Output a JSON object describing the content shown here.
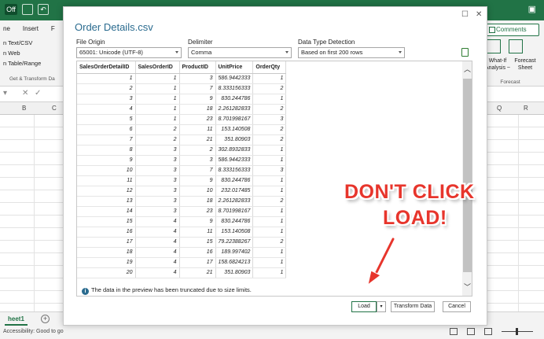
{
  "excel": {
    "titlebar_chip1": "Off",
    "ribbon_tabs": [
      "ne",
      "Insert",
      "F"
    ],
    "ribbon_left_items": [
      "n Text/CSV",
      "n Web",
      "n Table/Range"
    ],
    "ribbon_left_group": "Get & Transform Da",
    "comments_label": "Comments",
    "forecast": {
      "whatif": "What-If Analysis ~",
      "sheet": "Forecast Sheet",
      "group": "Forecast"
    },
    "formula_cancel": "✕",
    "formula_enter": "✓",
    "columns_left": [
      "B",
      "C"
    ],
    "columns_right": [
      "Q",
      "R"
    ],
    "sheet_tab": "heet1",
    "status_text": "Accessibility: Good to go"
  },
  "dialog": {
    "title": "Order Details.csv",
    "minimize_glyph": "☐",
    "close_glyph": "✕",
    "file_origin_label": "File Origin",
    "file_origin_value": "65001: Unicode (UTF-8)",
    "delimiter_label": "Delimiter",
    "delimiter_value": "Comma",
    "detection_label": "Data Type Detection",
    "detection_value": "Based on first 200 rows",
    "columns": [
      "SalesOrderDetailID",
      "SalesOrderID",
      "ProductID",
      "UnitPrice",
      "OrderQty"
    ],
    "rows": [
      [
        "1",
        "1",
        "3",
        "586.9442333",
        "1"
      ],
      [
        "2",
        "1",
        "7",
        "8.333156333",
        "2"
      ],
      [
        "3",
        "1",
        "9",
        "830.244786",
        "1"
      ],
      [
        "4",
        "1",
        "18",
        "2.261282833",
        "2"
      ],
      [
        "5",
        "1",
        "23",
        "8.701998167",
        "3"
      ],
      [
        "6",
        "2",
        "11",
        "153.140508",
        "2"
      ],
      [
        "7",
        "2",
        "21",
        "351.80903",
        "2"
      ],
      [
        "8",
        "3",
        "2",
        "302.8932833",
        "1"
      ],
      [
        "9",
        "3",
        "3",
        "586.9442333",
        "1"
      ],
      [
        "10",
        "3",
        "7",
        "8.333156333",
        "3"
      ],
      [
        "11",
        "3",
        "9",
        "830.244786",
        "1"
      ],
      [
        "12",
        "3",
        "10",
        "232.017485",
        "1"
      ],
      [
        "13",
        "3",
        "18",
        "2.261282833",
        "2"
      ],
      [
        "14",
        "3",
        "23",
        "8.701998167",
        "1"
      ],
      [
        "15",
        "4",
        "9",
        "830.244786",
        "1"
      ],
      [
        "16",
        "4",
        "11",
        "153.140508",
        "1"
      ],
      [
        "17",
        "4",
        "15",
        "79.22388267",
        "2"
      ],
      [
        "18",
        "4",
        "16",
        "189.997402",
        "1"
      ],
      [
        "19",
        "4",
        "17",
        "158.6824213",
        "1"
      ],
      [
        "20",
        "4",
        "21",
        "351.80903",
        "1"
      ]
    ],
    "truncation_note": "The data in the preview has been truncated due to size limits.",
    "load_label": "Load",
    "transform_label": "Transform Data",
    "cancel_label": "Cancel"
  },
  "annotation": {
    "line1": "DON'T CLICK",
    "line2": "LOAD!",
    "color": "#e7352c"
  }
}
